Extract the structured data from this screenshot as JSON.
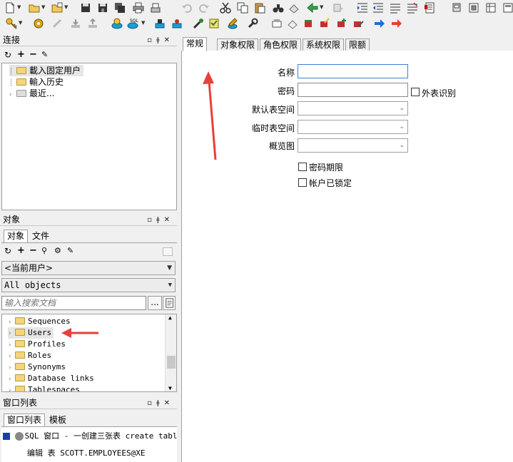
{
  "panels": {
    "connection": {
      "title": "连接",
      "items": [
        {
          "label": "載入固定用户"
        },
        {
          "label": "輸入历史"
        },
        {
          "label": "最近..."
        }
      ]
    },
    "objects": {
      "title": "对象",
      "tabs": [
        "对象",
        "文件"
      ],
      "user_combo": "<当前用户>",
      "filter_combo": "All objects",
      "search_placeholder": "输入搜索文档",
      "search_button": "...",
      "items": [
        {
          "label": "Sequences"
        },
        {
          "label": "Users"
        },
        {
          "label": "Profiles"
        },
        {
          "label": "Roles"
        },
        {
          "label": "Synonyms"
        },
        {
          "label": "Database links"
        },
        {
          "label": "Tablespaces"
        }
      ]
    },
    "windows": {
      "title": "窗口列表",
      "tabs": [
        "窗口列表",
        "模板"
      ],
      "items": [
        {
          "label": "SQL 窗口 - 一创建三张表 create tabl"
        },
        {
          "label": "编辑 表 SCOTT.EMPLOYEES@XE"
        }
      ]
    }
  },
  "editor": {
    "tabs": [
      "常规",
      "对象权限",
      "角色权限",
      "系统权限",
      "限额"
    ],
    "fields": {
      "name_label": "名称",
      "password_label": "密码",
      "external_label": "外表识别",
      "default_ts_label": "默认表空间",
      "temp_ts_label": "临时表空间",
      "profile_label": "概览图",
      "pwd_expire_label": "密码期限",
      "locked_label": "帐户已锁定"
    }
  },
  "colors": {
    "arrow": "#e8403a",
    "highlight": "#e6e6e6",
    "focus": "#3c7fd1"
  }
}
